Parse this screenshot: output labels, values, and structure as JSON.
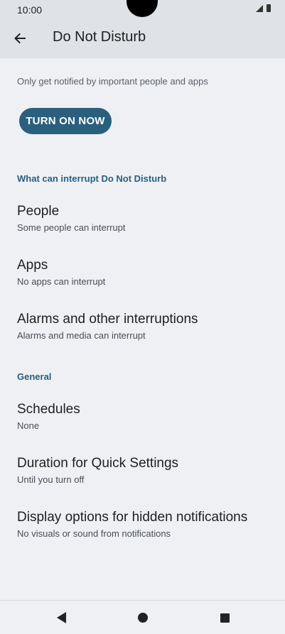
{
  "status_bar": {
    "time": "10:00"
  },
  "toolbar": {
    "title": "Do Not Disturb",
    "back_icon": "arrow-left-icon"
  },
  "main": {
    "description": "Only get notified by important people and apps",
    "turn_on_label": "TURN ON NOW",
    "sections": [
      {
        "header": "What can interrupt Do Not Disturb",
        "items": [
          {
            "title": "People",
            "subtitle": "Some people can interrupt"
          },
          {
            "title": "Apps",
            "subtitle": "No apps can interrupt"
          },
          {
            "title": "Alarms and other interruptions",
            "subtitle": "Alarms and media can interrupt"
          }
        ]
      },
      {
        "header": "General",
        "items": [
          {
            "title": "Schedules",
            "subtitle": "None"
          },
          {
            "title": "Duration for Quick Settings",
            "subtitle": "Until you turn off"
          },
          {
            "title": "Display options for hidden notifications",
            "subtitle": "No visuals or sound from notifications"
          }
        ]
      }
    ]
  },
  "colors": {
    "accent": "#2a5f7d",
    "toolbar_bg": "#dfe2e6",
    "page_bg": "#eef0f4"
  }
}
